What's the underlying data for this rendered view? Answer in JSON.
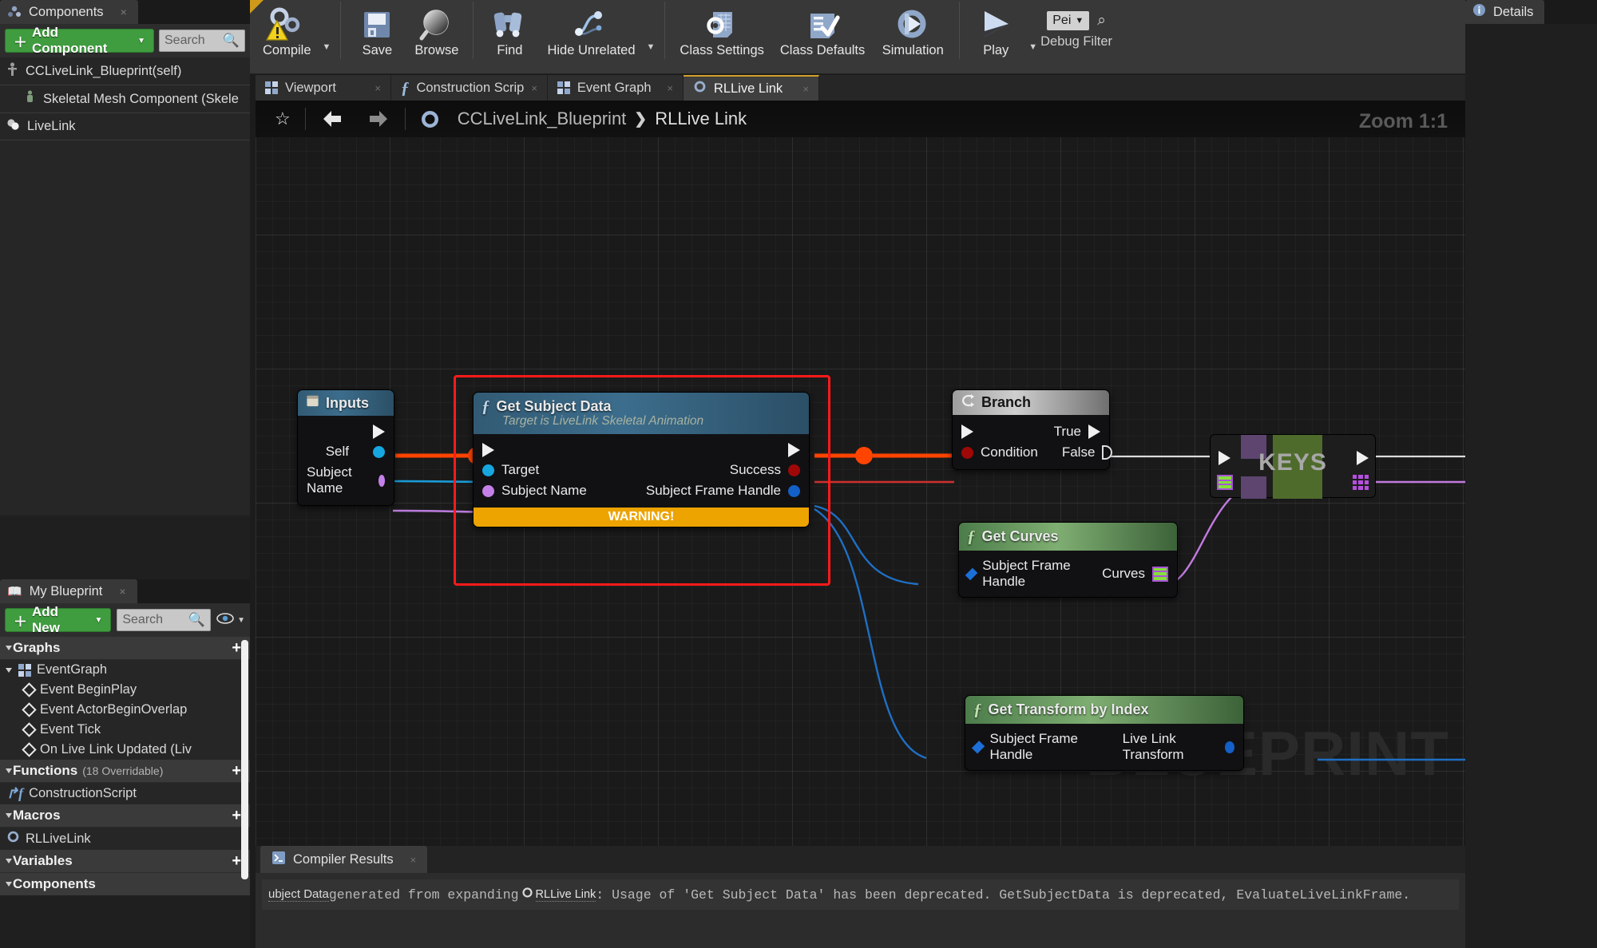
{
  "components_panel": {
    "tab_label": "Components",
    "tab_icon": "components-icon",
    "add_button": "Add Component",
    "add_caret": "▼",
    "search_placeholder": "Search",
    "items": [
      {
        "label": "CCLiveLink_Blueprint(self)",
        "icon": "actor-icon",
        "indent": 0
      },
      {
        "label": "Skeletal Mesh Component (Skele",
        "icon": "skeletal-mesh-icon",
        "indent": 1
      },
      {
        "label": "LiveLink",
        "icon": "livelink-icon",
        "indent": 0
      }
    ]
  },
  "my_blueprint_panel": {
    "tab_label": "My Blueprint",
    "add_button": "Add New",
    "add_caret": "▼",
    "search_placeholder": "Search",
    "sections": [
      {
        "title": "Graphs",
        "note": "",
        "plus": "+"
      },
      {
        "title": "Functions",
        "note": "(18 Overridable)",
        "plus": "+"
      },
      {
        "title": "Macros",
        "note": "",
        "plus": "+"
      },
      {
        "title": "Variables",
        "note": "",
        "plus": "+"
      },
      {
        "title": "Components",
        "note": "",
        "plus": "+"
      }
    ],
    "graphs": [
      {
        "label": "EventGraph",
        "icon": "graph-icon",
        "level": 1
      },
      {
        "label": "Event BeginPlay",
        "icon": "event-node-icon",
        "level": 2
      },
      {
        "label": "Event ActorBeginOverlap",
        "icon": "event-node-icon",
        "level": 2
      },
      {
        "label": "Event Tick",
        "icon": "event-node-icon",
        "level": 2
      },
      {
        "label": "On Live Link Updated (Liv",
        "icon": "event-node-icon",
        "level": 2
      }
    ],
    "functions": [
      {
        "label": "ConstructionScript",
        "icon": "construction-script-icon",
        "level": 1
      }
    ],
    "macros": [
      {
        "label": "RLLiveLink",
        "icon": "macro-gear-icon",
        "level": 1
      }
    ]
  },
  "toolbar": {
    "items": [
      {
        "label": "Compile",
        "icon": "compile-gears-warning-icon",
        "has_caret": true
      },
      {
        "label": "Save",
        "icon": "save-floppy-icon",
        "has_caret": false
      },
      {
        "label": "Browse",
        "icon": "browse-magnifier-icon",
        "has_caret": false
      },
      {
        "label": "Find",
        "icon": "find-binoculars-icon",
        "has_caret": false
      },
      {
        "label": "Hide Unrelated",
        "icon": "hide-unrelated-icon",
        "has_caret": true
      },
      {
        "label": "Class Settings",
        "icon": "class-settings-icon",
        "has_caret": false
      },
      {
        "label": "Class Defaults",
        "icon": "class-defaults-icon",
        "has_caret": false
      },
      {
        "label": "Simulation",
        "icon": "simulation-icon",
        "has_caret": false
      },
      {
        "label": "Play",
        "icon": "play-icon",
        "has_caret": true
      }
    ],
    "debug_filter_value": "Pei",
    "debug_filter_caret": "▼",
    "debug_filter_label": "Debug Filter"
  },
  "graph_tabs": [
    {
      "label": "Viewport",
      "icon": "viewport-icon",
      "active": false,
      "close": "×"
    },
    {
      "label": "Construction Scrip",
      "icon": "function-fx-icon",
      "active": false,
      "close": "×"
    },
    {
      "label": "Event Graph",
      "icon": "graph-icon",
      "active": false,
      "close": "×"
    },
    {
      "label": "RLLive Link",
      "icon": "macro-gear-icon",
      "active": true,
      "close": "×"
    }
  ],
  "breadcrumb": {
    "star_icon": "star-icon",
    "back_icon": "back-arrow-icon",
    "forward_icon": "forward-arrow-icon",
    "graph_icon": "macro-gear-icon",
    "crumb1": "CCLiveLink_Blueprint",
    "separator": "❯",
    "crumb2": "RLLive Link",
    "zoom_label": "Zoom 1:1",
    "watermark": "BLUEPRINT"
  },
  "nodes": {
    "inputs": {
      "title": "Inputs",
      "icon": "tunnel-node-icon",
      "outputs": [
        {
          "label": "",
          "pin": "exec"
        },
        {
          "label": "Self",
          "pin": "object-blue"
        },
        {
          "label": "Subject Name",
          "pin": "name-purple"
        }
      ]
    },
    "get_subject_data": {
      "title": "Get Subject Data",
      "icon": "function-fx-icon",
      "subtitle": "Target is LiveLink Skeletal Animation",
      "inputs": [
        {
          "label": "",
          "pin": "exec"
        },
        {
          "label": "Target",
          "pin": "object-blue"
        },
        {
          "label": "Subject Name",
          "pin": "name-purple"
        }
      ],
      "outputs": [
        {
          "label": "",
          "pin": "exec"
        },
        {
          "label": "Success",
          "pin": "bool-red"
        },
        {
          "label": "Subject Frame Handle",
          "pin": "struct-darkblue"
        }
      ],
      "warning": "WARNING!",
      "selected": true,
      "selection_color": "#ff1a1a"
    },
    "branch": {
      "title": "Branch",
      "icon": "branch-icon",
      "inputs": [
        {
          "label": "",
          "pin": "exec"
        },
        {
          "label": "Condition",
          "pin": "bool-red"
        }
      ],
      "outputs": [
        {
          "label": "True",
          "pin": "exec"
        },
        {
          "label": "False",
          "pin": "exec-hollow"
        }
      ]
    },
    "get_curves": {
      "title": "Get Curves",
      "icon": "function-fx-icon",
      "inputs": [
        {
          "label": "Subject Frame Handle",
          "pin": "struct-diamond"
        }
      ],
      "outputs": [
        {
          "label": "Curves",
          "pin": "map-list"
        }
      ]
    },
    "get_transform_by_index": {
      "title": "Get Transform by Index",
      "icon": "function-fx-icon",
      "inputs": [
        {
          "label": "Subject Frame Handle",
          "pin": "struct-diamond"
        }
      ],
      "outputs": [
        {
          "label": "Live Link Transform",
          "pin": "struct-darkblue"
        }
      ]
    },
    "keys": {
      "title": "KEYS",
      "inputs": [
        {
          "pin": "exec"
        },
        {
          "pin": "map-list"
        }
      ],
      "outputs": [
        {
          "pin": "exec"
        },
        {
          "pin": "set-grid"
        }
      ]
    }
  },
  "compiler_results": {
    "tab_label": "Compiler Results",
    "tab_icon": "compiler-results-icon",
    "message_pre": "ubject Data",
    "message_mid": " generated from expanding ",
    "message_link": "RLLive Link",
    "message_post": " : Usage of 'Get Subject Data' has been deprecated. GetSubjectData is deprecated, EvaluateLiveLinkFrame."
  },
  "details_panel": {
    "tab_label": "Details",
    "tab_icon": "details-icon"
  },
  "colors": {
    "accent_green": "#3f9c3f",
    "selection_red": "#ff1a1a",
    "warning_orange": "#eda300",
    "exec_wire_orange": "#ff4a00",
    "tab_highlight": "#d3a128"
  }
}
